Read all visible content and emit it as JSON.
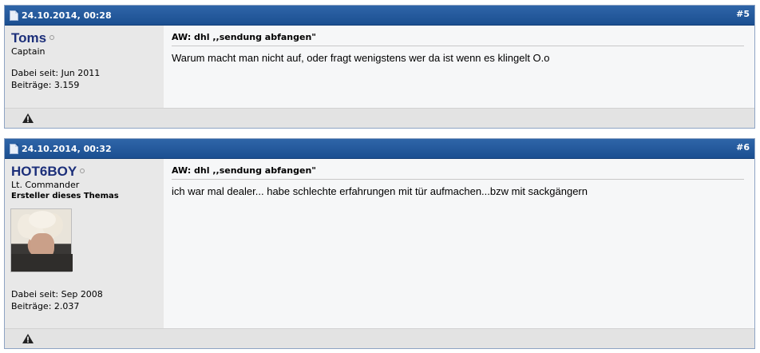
{
  "posts": [
    {
      "date": "24.10.2014, 00:28",
      "number": "#5",
      "username": "Toms",
      "usertitle": "Captain",
      "joined": "Dabei seit: Jun 2011",
      "posts_count": "Beiträge: 3.159",
      "title": "AW: dhl ,,sendung abfangen\"",
      "text": "Warum macht man nicht auf, oder fragt wenigstens wer da ist wenn es klingelt O.o"
    },
    {
      "date": "24.10.2014, 00:32",
      "number": "#6",
      "username": "HOT6BOY",
      "usertitle": "Lt. Commander",
      "usertitle2": "Ersteller dieses Themas",
      "joined": "Dabei seit: Sep 2008",
      "posts_count": "Beiträge: 2.037",
      "title": "AW: dhl ,,sendung abfangen\"",
      "text": "ich war mal dealer... habe schlechte erfahrungen mit tür aufmachen...bzw mit sackgängern"
    }
  ]
}
